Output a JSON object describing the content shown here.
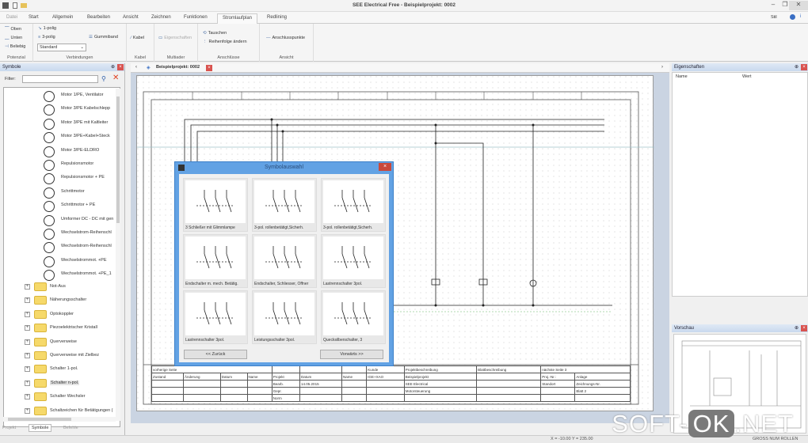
{
  "window": {
    "title": "SEE Electrical Free - Beispielprojekt: 0002",
    "minimize": "–",
    "restore": "❐",
    "close": "✕"
  },
  "tabs": [
    "Datei",
    "Start",
    "Allgemein",
    "Bearbeiten",
    "Ansicht",
    "Zeichnen",
    "Funktionen",
    "Stromlaufplan",
    "Redlining"
  ],
  "tabs_right": {
    "style": "Stil"
  },
  "ribbon": {
    "potenzial": {
      "label": "Potenzial",
      "items": [
        "Oben",
        "Unten",
        "Beliebig"
      ]
    },
    "verbindungen": {
      "label": "Verbindungen",
      "items": [
        "1-polig",
        "3-polig",
        "Gummiband"
      ],
      "select": "Standard"
    },
    "kabel": {
      "label": "Kabel",
      "items": [
        "Kabel"
      ]
    },
    "multiader": {
      "label": "Multiader",
      "items": [
        "Eigenschaften"
      ]
    },
    "anschluesse": {
      "label": "Anschlüsse",
      "items": [
        "Tauschen",
        "Reihenfolge ändern"
      ]
    },
    "ansicht": {
      "label": "Ansicht",
      "items": [
        "Anschlusspunkte"
      ]
    }
  },
  "left_panel": {
    "title": "Symbole",
    "filter_label": "Filter:",
    "filter_value": "",
    "symbols": [
      "Motor 1/PE, Ventilator",
      "Motor 3/PE Kabelschlepp",
      "Motor 3/PE mit Kaltleiter",
      "Motor 3/PE+Kabel+Steck",
      "Motor 3/PE-ELDRO",
      "Repulsionsmotor",
      "Repulsionsmotor + PE",
      "Schrittmotor",
      "Schrittmotor + PE",
      "Umformer DC - DC mit gen",
      "Wechselstrom-Reihenschl",
      "Wechselstrom-Reihenschl",
      "Wechselstrommot. +PE",
      "Wechselstrommot. +PE_1"
    ],
    "folders": [
      "Not-Aus",
      "Näherungsschalter",
      "Optokoppler",
      "Piezoelektrischer Kristall",
      "Querverweise",
      "Querverweise mit Zielbez",
      "Schalter 1-pol.",
      "Schalter n-pol.",
      "Schalter Wechsler",
      "Schaltzeichen für Betätigungen ("
    ],
    "selected_folder": "Schalter n-pol.",
    "bottom_tabs": [
      "Projekt",
      "Symbole",
      "Befehle"
    ]
  },
  "document": {
    "tab": "Beispielprojekt: 0002"
  },
  "title_block": {
    "prev_page": "vorherige Seite",
    "cols": [
      "Zustand",
      "Änderung",
      "Datum",
      "Name"
    ],
    "project": "Projekt",
    "date": "Datum",
    "name": "Name",
    "bearb": "Bearb.",
    "bearb_date": "14.05.2015",
    "gepr": "Gepr.",
    "norm": "Norm",
    "kunde": "Kunde",
    "kunde_name": "IGE+XAO",
    "proj_desc": "Projektbeschreibung",
    "proj_lines": [
      "Beispielprojekt",
      "SEE Electrical",
      "Motorsteuerung"
    ],
    "sheet_desc": "Blattbeschreibung",
    "next_page": "nächste Seite 3",
    "proj_nr": "Proj.-Nr.:",
    "anlage": "Anlage",
    "standort": "Standort",
    "zeichnung": "Zeichnungs-Nr.",
    "blatt": "Blatt 2"
  },
  "dialog": {
    "title": "Symbolauswahl",
    "cells": [
      "3 Schließer mit Glimmlampe",
      "3-pol. rollenbetätigt,Sicherh.",
      "3-pol. rollenbetätigt,Sicherh.",
      "Endschalter m. mech. Betätig.",
      "Endschalter, Schliesser, Öffner",
      "Lastrennschalter 3pol.",
      "Lastrennschalter 3pol.",
      "Leistungsschalter 3pol.",
      "Quecksilberschalter, 3"
    ],
    "back": "<< Zurück",
    "next": "Vorwärts >>"
  },
  "right_panel": {
    "properties_title": "Eigenschaften",
    "col_name": "Name",
    "col_value": "Wert",
    "preview_title": "Vorschau"
  },
  "status": {
    "coords": "X = -10.00  Y = 235.00",
    "indicators": "GROSS NUM ROLLEN"
  },
  "watermark": {
    "a": "SOFT-",
    "b": "OK",
    "c": ".NET"
  }
}
